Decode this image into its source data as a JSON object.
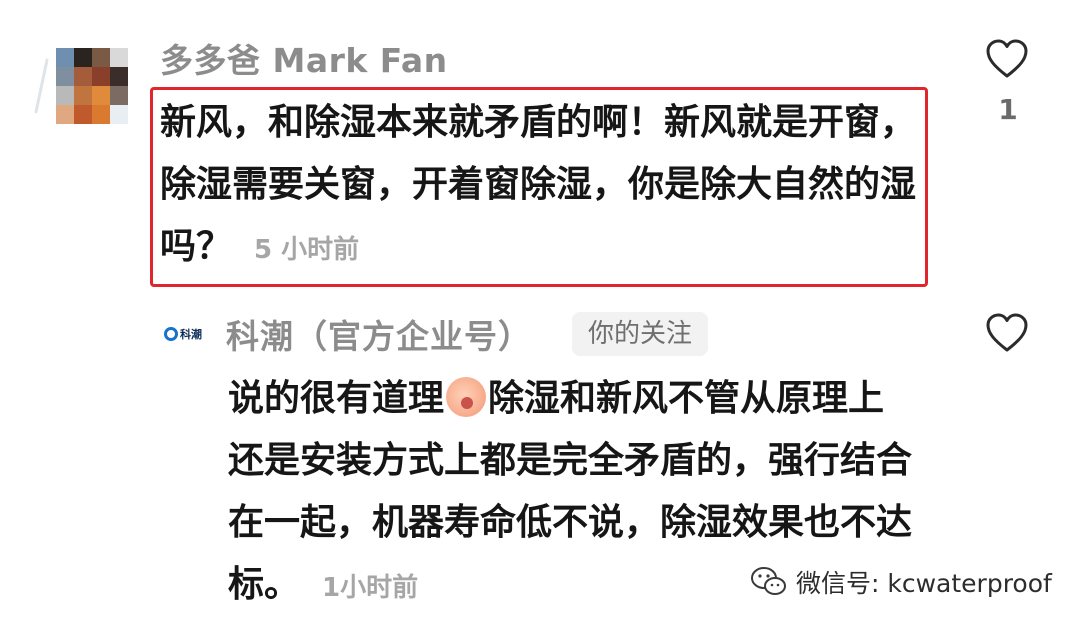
{
  "comment1": {
    "username": "多多爸 Mark Fan",
    "text": "新风，和除湿本来就矛盾的啊！新风就是开窗，除湿需要关窗，开着窗除湿，你是除大自然的湿吗？",
    "time": "5 小时前",
    "like_count": "1",
    "icons": {
      "like": "heart-outline-icon"
    },
    "highlight_color": "#e1252c"
  },
  "reply": {
    "logo_text": "科潮",
    "username": "科潮（官方企业号）",
    "follow_badge": "你的关注",
    "text_before_emoji": "说的很有道理",
    "emoji": "blushing-face-emoji",
    "text_after_emoji": "除湿和新风不管从原理上还是安装方式上都是完全矛盾的，强行结合在一起，机器寿命低不说，除湿效果也不达标。",
    "time": "1小时前",
    "icons": {
      "like": "heart-outline-icon"
    }
  },
  "watermark": {
    "text": "微信号: kcwaterproof",
    "icon": "wechat-icon"
  }
}
